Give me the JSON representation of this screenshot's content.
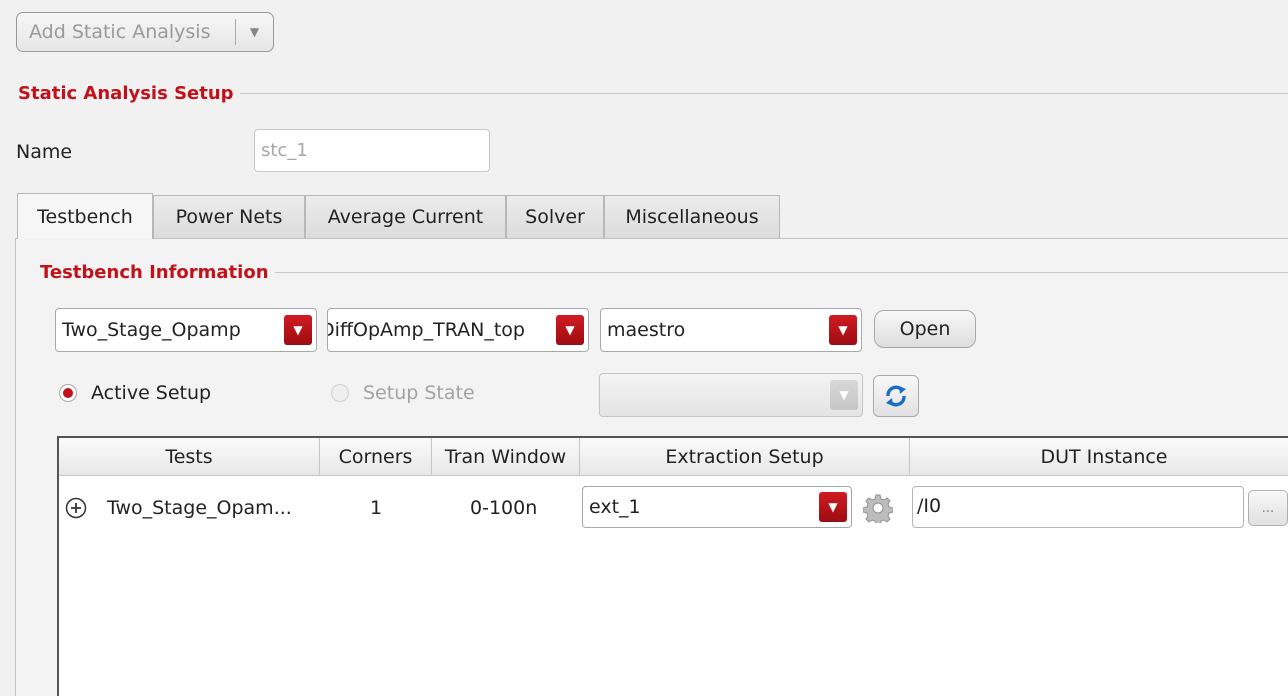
{
  "toolbar": {
    "add_label": "Add Static Analysis"
  },
  "setup": {
    "section_title": "Static Analysis Setup",
    "name_label": "Name",
    "name_value": "stc_1"
  },
  "tabs": [
    {
      "label": "Testbench",
      "active": true
    },
    {
      "label": "Power Nets"
    },
    {
      "label": "Average Current"
    },
    {
      "label": "Solver"
    },
    {
      "label": "Miscellaneous"
    }
  ],
  "testbench": {
    "section_title": "Testbench Information",
    "library": "Two_Stage_Opamp",
    "cell": "DiffOpAmp_TRAN_top",
    "view": "maestro",
    "open_label": "Open",
    "active_setup_label": "Active Setup",
    "setup_state_label": "Setup State",
    "setup_state_value": ""
  },
  "table": {
    "headers": [
      "Tests",
      "Corners",
      "Tran Window",
      "Extraction Setup",
      "DUT Instance"
    ],
    "rows": [
      {
        "test": "Two_Stage_Opam...",
        "corners": "1",
        "tran_window": "0-100n",
        "extraction": "ext_1",
        "dut": "/I0",
        "browse": "..."
      }
    ]
  },
  "colors": {
    "accent": "#c1121b",
    "dropdown": "#b81219"
  }
}
